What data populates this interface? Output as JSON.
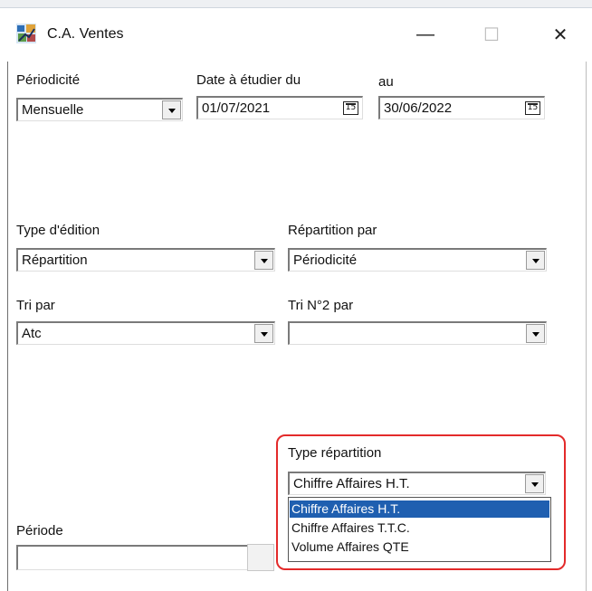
{
  "window": {
    "title": "C.A. Ventes",
    "minimize_glyph": "—",
    "maximize_glyph": "☐",
    "close_glyph": "✕",
    "icon": "app-ventes-icon"
  },
  "form": {
    "periodicite": {
      "label": "Périodicité",
      "value": "Mensuelle"
    },
    "date_du": {
      "label": "Date à étudier du",
      "value": "01/07/2021",
      "calendar_glyph": "15"
    },
    "date_au": {
      "label": "au",
      "value": "30/06/2022",
      "calendar_glyph": "15"
    },
    "type_edition": {
      "label": "Type d'édition",
      "value": "Répartition"
    },
    "repartition_par": {
      "label": "Répartition par",
      "value": "Périodicité"
    },
    "tri_par": {
      "label": "Tri par",
      "value": "Atc"
    },
    "tri2_par": {
      "label": "Tri N°2 par",
      "value": ""
    },
    "periode": {
      "label": "Période",
      "value": ""
    },
    "type_repartition": {
      "label": "Type répartition",
      "value": "Chiffre Affaires H.T.",
      "options": [
        "Chiffre Affaires H.T.",
        "Chiffre Affaires T.T.C.",
        "Volume Affaires QTE"
      ],
      "selected_index": 0
    }
  },
  "colors": {
    "highlight": "#e32a2a",
    "selection": "#1f5fb0"
  }
}
